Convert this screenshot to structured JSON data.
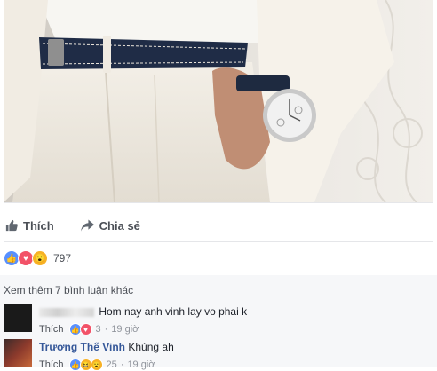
{
  "post": {
    "actions": {
      "like_label": "Thích",
      "share_label": "Chia sẻ"
    },
    "reactions": {
      "icons": [
        "like-icon",
        "love-icon",
        "wow-icon"
      ],
      "count": "797"
    },
    "comments": {
      "view_more": "Xem thêm 7 bình luận khác",
      "items": [
        {
          "author": "",
          "text": "Hom nay anh vinh lay vo phai k",
          "like_label": "Thích",
          "react_count": "3",
          "dot": "·",
          "time": "19 giờ"
        },
        {
          "author": "Trương Thế Vinh",
          "text": "Khùng ah",
          "like_label": "Thích",
          "react_count": "25",
          "dot": "·",
          "time": "19 giờ"
        }
      ]
    }
  },
  "colors": {
    "link": "#365899",
    "like_blue": "#5890ff",
    "love_red": "#f25268",
    "wow_yellow": "#f7b125",
    "divider": "#e5e6e9"
  }
}
